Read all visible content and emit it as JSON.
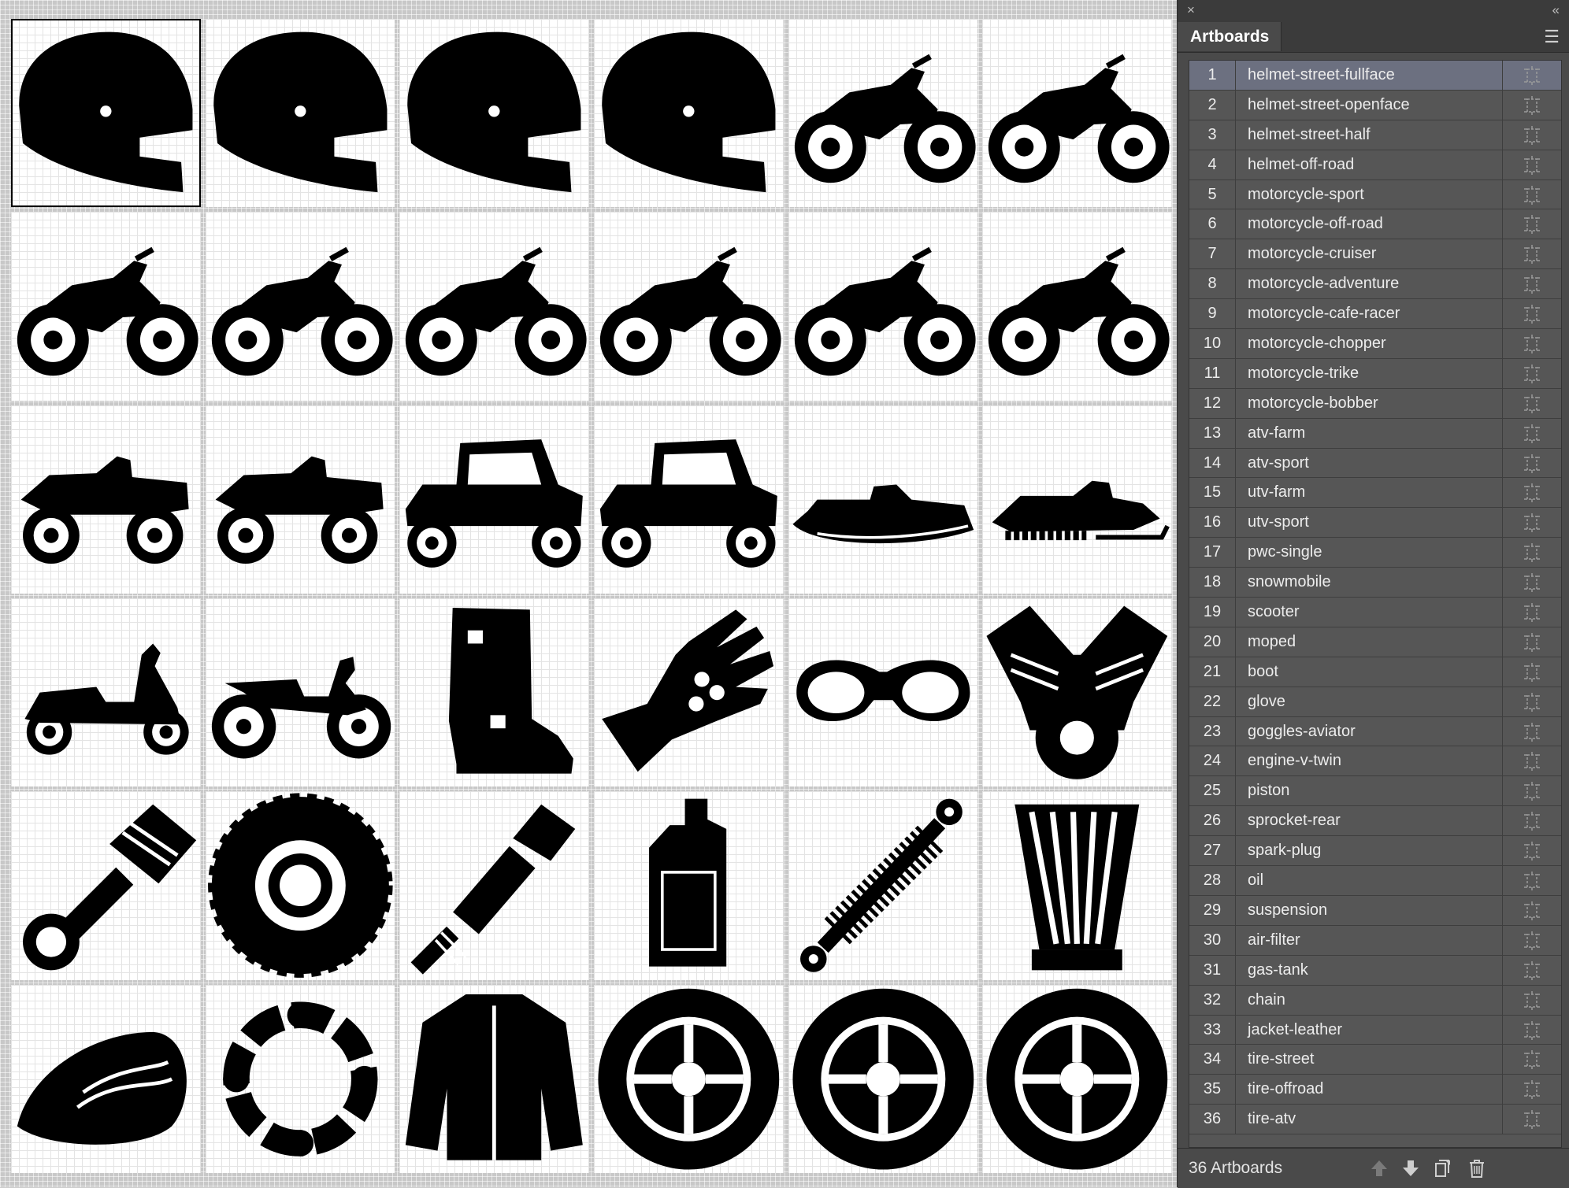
{
  "panel": {
    "tab_label": "Artboards",
    "close_glyph": "×",
    "collapse_glyph": "«",
    "menu_glyph": "☰",
    "count_label": "36 Artboards",
    "selected_index": 0,
    "accent_selected": "#6c7080",
    "artboards": [
      {
        "num": "1",
        "name": "helmet-street-fullface"
      },
      {
        "num": "2",
        "name": "helmet-street-openface"
      },
      {
        "num": "3",
        "name": "helmet-street-half"
      },
      {
        "num": "4",
        "name": "helmet-off-road"
      },
      {
        "num": "5",
        "name": "motorcycle-sport"
      },
      {
        "num": "6",
        "name": "motorcycle-off-road"
      },
      {
        "num": "7",
        "name": "motorcycle-cruiser"
      },
      {
        "num": "8",
        "name": "motorcycle-adventure"
      },
      {
        "num": "9",
        "name": "motorcycle-cafe-racer"
      },
      {
        "num": "10",
        "name": "motorcycle-chopper"
      },
      {
        "num": "11",
        "name": "motorcycle-trike"
      },
      {
        "num": "12",
        "name": "motorcycle-bobber"
      },
      {
        "num": "13",
        "name": "atv-farm"
      },
      {
        "num": "14",
        "name": "atv-sport"
      },
      {
        "num": "15",
        "name": "utv-farm"
      },
      {
        "num": "16",
        "name": "utv-sport"
      },
      {
        "num": "17",
        "name": "pwc-single"
      },
      {
        "num": "18",
        "name": "snowmobile"
      },
      {
        "num": "19",
        "name": "scooter"
      },
      {
        "num": "20",
        "name": "moped"
      },
      {
        "num": "21",
        "name": "boot"
      },
      {
        "num": "22",
        "name": "glove"
      },
      {
        "num": "23",
        "name": "goggles-aviator"
      },
      {
        "num": "24",
        "name": "engine-v-twin"
      },
      {
        "num": "25",
        "name": "piston"
      },
      {
        "num": "26",
        "name": "sprocket-rear"
      },
      {
        "num": "27",
        "name": "spark-plug"
      },
      {
        "num": "28",
        "name": "oil"
      },
      {
        "num": "29",
        "name": "suspension"
      },
      {
        "num": "30",
        "name": "air-filter"
      },
      {
        "num": "31",
        "name": "gas-tank"
      },
      {
        "num": "32",
        "name": "chain"
      },
      {
        "num": "33",
        "name": "jacket-leather"
      },
      {
        "num": "34",
        "name": "tire-street"
      },
      {
        "num": "35",
        "name": "tire-offroad"
      },
      {
        "num": "36",
        "name": "tire-atv"
      }
    ]
  },
  "canvas": {
    "icon_types": [
      "helmet",
      "helmet",
      "helmet",
      "helmet",
      "motorcycle",
      "motorcycle",
      "motorcycle",
      "motorcycle",
      "motorcycle",
      "motorcycle",
      "motorcycle",
      "motorcycle",
      "atv",
      "atv",
      "utv",
      "utv",
      "pwc",
      "snowmobile",
      "scooter",
      "moped",
      "boot",
      "glove",
      "goggles",
      "engine",
      "piston",
      "sprocket",
      "spark-plug",
      "oil",
      "suspension",
      "air-filter",
      "gas-tank",
      "chain",
      "jacket",
      "tire",
      "tire",
      "tire"
    ]
  }
}
